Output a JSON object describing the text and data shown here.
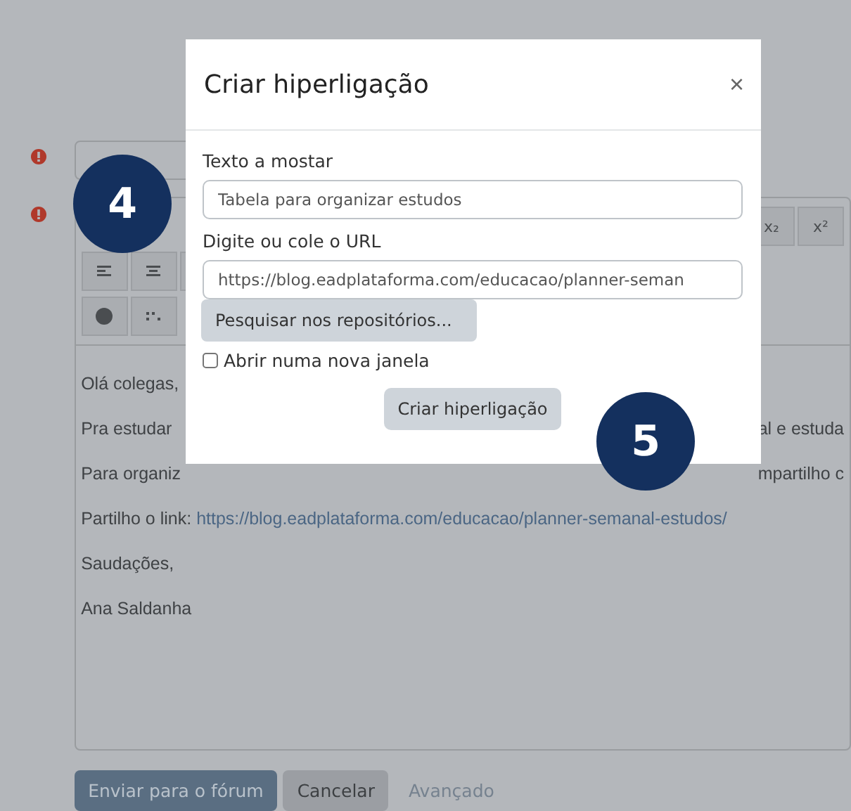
{
  "page": {
    "error_marks": [
      {
        "kind": "error"
      },
      {
        "kind": "error"
      }
    ],
    "toolbar_top": [
      "x₂",
      "x²"
    ],
    "message_lines": [
      {
        "left": "Olá colegas,"
      },
      {
        "left": "Pra estudar",
        "right": "al e estuda"
      },
      {
        "left": "Para organiz",
        "right": "mpartilho c"
      },
      {
        "left": "Partilho o link: ",
        "link": "https://blog.eadplataforma.com/educacao/planner-semanal-estudos/"
      },
      {
        "left": "Saudações,"
      },
      {
        "left": "Ana Saldanha"
      }
    ],
    "buttons": [
      {
        "label": "Enviar para o fórum",
        "kind": "primary"
      },
      {
        "label": "Cancelar",
        "kind": "secondary"
      },
      {
        "label": "Avançado",
        "kind": "link"
      }
    ]
  },
  "dialog": {
    "title": "Criar hiperligação",
    "close": "×",
    "text_label": "Texto a mostar",
    "text_value": "Tabela para organizar estudos",
    "url_label": "Digite ou cole o URL",
    "url_value": "https://blog.eadplataforma.com/educacao/planner-seman",
    "browse_button": "Pesquisar nos repositórios...",
    "new_window": {
      "label": "Abrir numa nova janela",
      "checked": false
    },
    "submit": "Criar hiperligação"
  },
  "step_badges": [
    {
      "label": "4"
    },
    {
      "label": "5"
    }
  ]
}
